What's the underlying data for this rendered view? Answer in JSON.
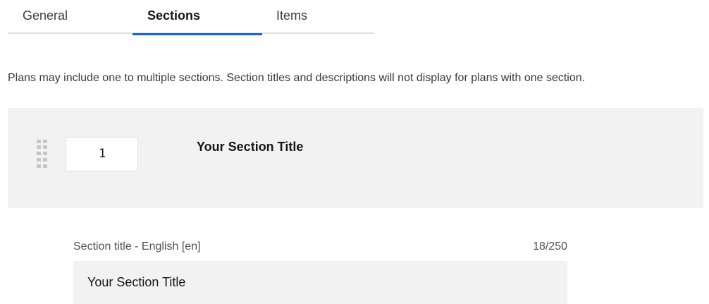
{
  "tabs": {
    "general": "General",
    "sections": "Sections",
    "items": "Items",
    "active": "Sections",
    "active_color": "#0f62fe"
  },
  "description": "Plans may include one to multiple sections. Section titles and descriptions will not display for plans with one section.",
  "section": {
    "order": "1",
    "heading": "Your Section Title",
    "drag_icon": "drag-handle-icon"
  },
  "field": {
    "label": "Section title - English [en]",
    "counter": "18/250",
    "value": "Your Section Title"
  }
}
